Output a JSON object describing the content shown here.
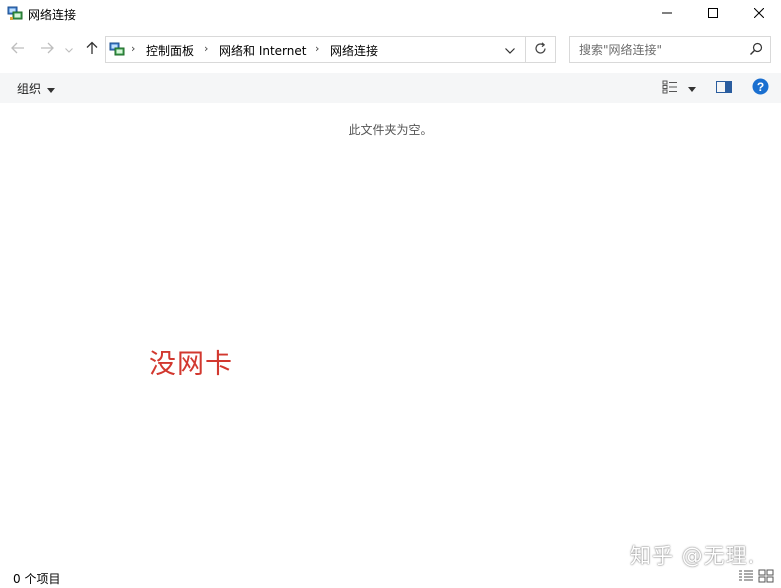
{
  "window": {
    "title": "网络连接",
    "icon": "network-connections-icon",
    "controls": [
      "minimize-icon",
      "maximize-icon",
      "close-icon"
    ]
  },
  "navigation": {
    "back_icon": "arrow-left-icon",
    "forward_icon": "arrow-right-icon",
    "recent_icon": "chevron-down-icon",
    "up_icon": "arrow-up-icon"
  },
  "address_bar": {
    "breadcrumbs": [
      "控制面板",
      "网络和 Internet",
      "网络连接"
    ],
    "separator": "›",
    "dropdown_icon": "chevron-down-icon",
    "refresh_icon": "refresh-icon"
  },
  "search": {
    "placeholder": "搜索\"网络连接\"",
    "icon": "search-icon"
  },
  "command_bar": {
    "organize_label": "组织",
    "view_icon": "change-view-icon",
    "preview_pane_icon": "preview-pane-icon",
    "help_icon": "help-icon"
  },
  "content": {
    "empty_message": "此文件夹为空。",
    "annotation": "没网卡"
  },
  "status_bar": {
    "item_count": "0 个项目"
  },
  "watermark": "知乎 @无理.",
  "colors": {
    "annotation": "#d2382f",
    "command_bar_bg": "#f5f6f7",
    "help_blue": "#1a6fd0"
  }
}
